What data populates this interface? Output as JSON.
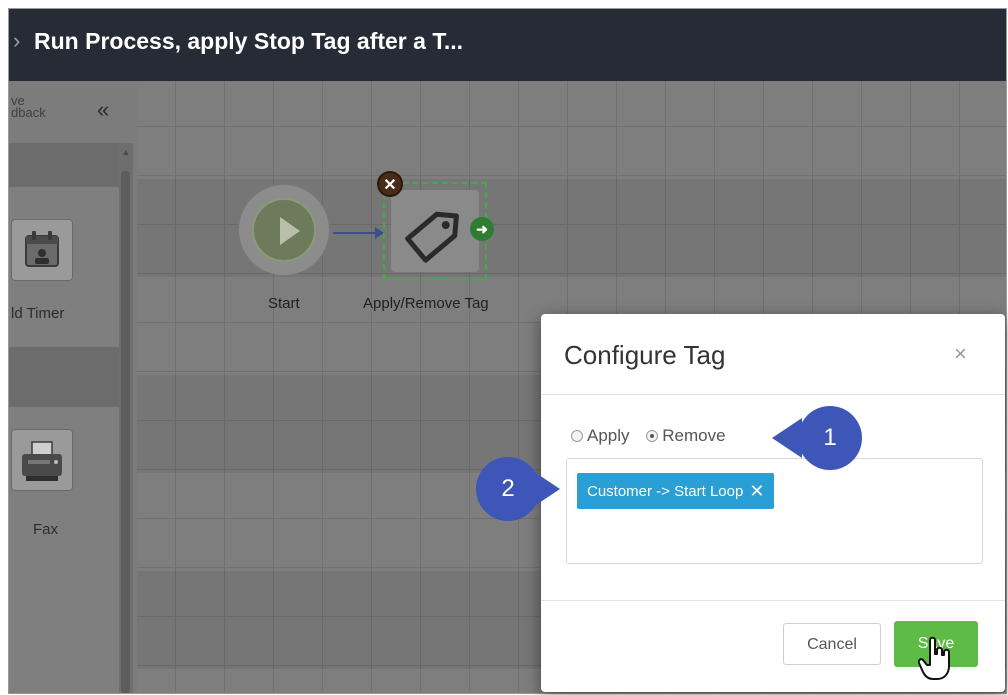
{
  "header": {
    "title": "Run Process, apply Stop Tag after a T..."
  },
  "sidebar": {
    "header_text": "ve\ndback",
    "collapse_label": "«",
    "items": [
      {
        "label": "ld Timer",
        "icon": "calendar-icon"
      },
      {
        "label": "Fax",
        "icon": "fax-icon"
      }
    ]
  },
  "canvas": {
    "nodes": [
      {
        "label": "Start",
        "icon": "play-icon"
      },
      {
        "label": "Apply/Remove Tag",
        "icon": "tag-icon"
      }
    ]
  },
  "modal": {
    "title": "Configure Tag",
    "close_label": "×",
    "radios": [
      {
        "label": "Apply",
        "selected": false
      },
      {
        "label": "Remove",
        "selected": true
      }
    ],
    "tags": [
      {
        "label": "Customer -> Start Loop"
      }
    ],
    "cancel_label": "Cancel",
    "save_label": "Save"
  },
  "callouts": [
    {
      "number": "1"
    },
    {
      "number": "2"
    }
  ],
  "colors": {
    "topbar": "#262b36",
    "chip": "#2a9fd6",
    "save": "#5dbb46",
    "callout": "#3d56b8"
  }
}
